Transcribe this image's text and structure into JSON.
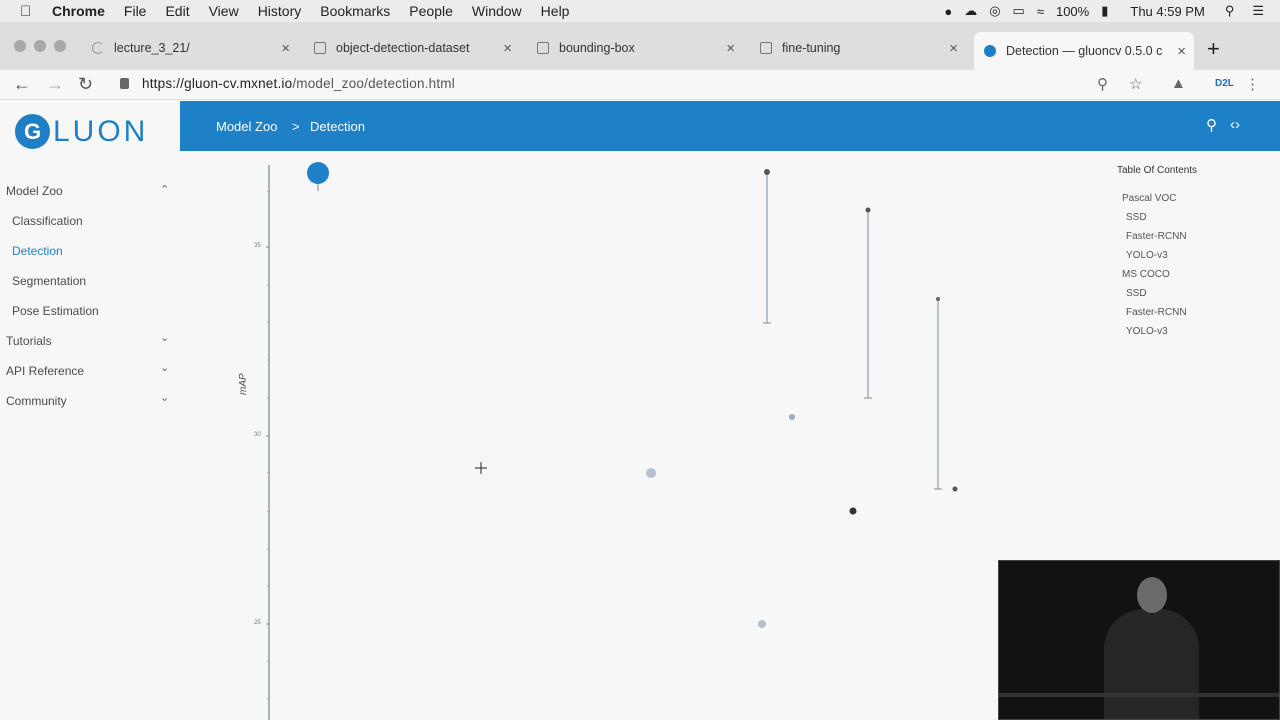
{
  "menubar": {
    "app": "Chrome",
    "items": [
      "File",
      "Edit",
      "View",
      "History",
      "Bookmarks",
      "People",
      "Window",
      "Help"
    ],
    "battery": "100%",
    "clock": "Thu 4:59 PM"
  },
  "tabs": [
    {
      "label": "lecture_3_21/"
    },
    {
      "label": "object-detection-dataset"
    },
    {
      "label": "bounding-box"
    },
    {
      "label": "fine-tuning"
    },
    {
      "label": "Detection — gluoncv 0.5.0 c"
    }
  ],
  "address": {
    "url_host": "https://gluon-cv.mxnet.io",
    "url_path": "/model_zoo/detection.html",
    "d2l": "D2L"
  },
  "sidebar": {
    "logo_text": "LUON",
    "items": [
      {
        "label": "Model Zoo"
      },
      {
        "label": "Classification"
      },
      {
        "label": "Detection"
      },
      {
        "label": "Segmentation"
      },
      {
        "label": "Pose Estimation"
      },
      {
        "label": "Tutorials"
      },
      {
        "label": "API Reference"
      },
      {
        "label": "Community"
      }
    ]
  },
  "header": {
    "crumb1": "Model Zoo",
    "sep": ">",
    "crumb2": "Detection"
  },
  "toc": {
    "title": "Table Of Contents",
    "items": [
      "Pascal VOC",
      "SSD",
      "Faster-RCNN",
      "YOLO-v3",
      "MS COCO",
      "SSD",
      "Faster-RCNN",
      "YOLO-v3"
    ]
  },
  "chart_data": {
    "type": "scatter",
    "ylabel": "mAP",
    "yticks": [
      "35",
      "30",
      "25"
    ]
  },
  "colors": {
    "brand": "#1e80c6"
  }
}
